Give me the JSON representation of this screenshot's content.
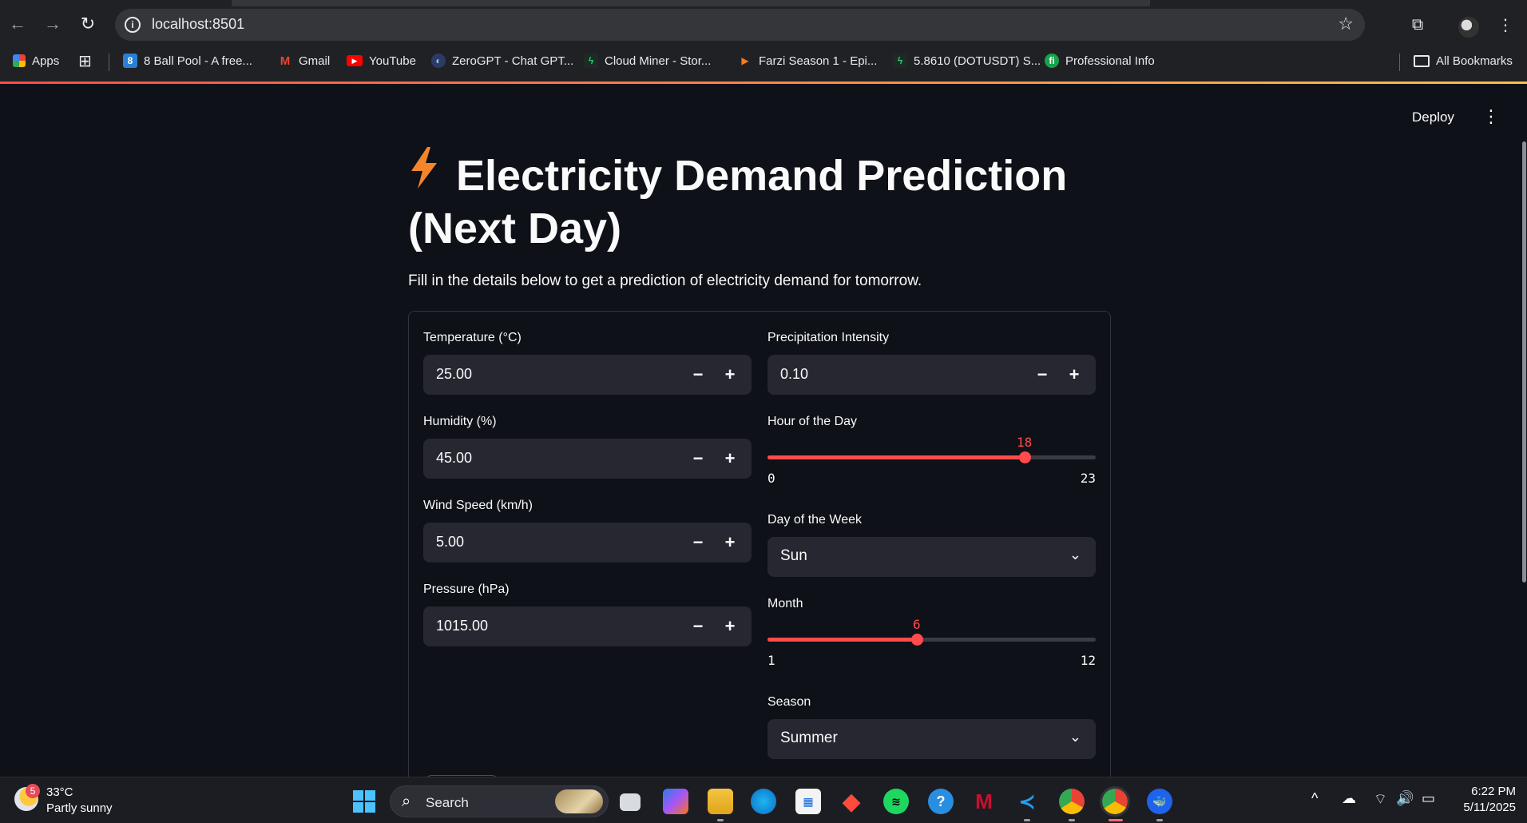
{
  "browser": {
    "url": "localhost:8501",
    "bookmarks": [
      {
        "label": "Apps",
        "icon": "apps-grid-icon"
      },
      {
        "label": "8 Ball Pool - A free...",
        "icon": "8ball-pool-favicon"
      },
      {
        "label": "Gmail",
        "icon": "gmail-icon"
      },
      {
        "label": "YouTube",
        "icon": "youtube-icon"
      },
      {
        "label": "ZeroGPT - Chat GPT...",
        "icon": "zerogpt-favicon"
      },
      {
        "label": "Cloud Miner - Stor...",
        "icon": "cloud-miner-favicon"
      },
      {
        "label": "Farzi Season 1 - Epi...",
        "icon": "play-favicon"
      },
      {
        "label": "5.8610 (DOTUSDT) S...",
        "icon": "dotusdt-favicon"
      },
      {
        "label": "Professional Info",
        "icon": "professional-info-favicon"
      }
    ],
    "all_bookmarks_label": "All Bookmarks"
  },
  "app": {
    "deploy_label": "Deploy",
    "title_line1": "Electricity Demand Prediction",
    "title_line2": "(Next Day)",
    "subtitle": "Fill in the details below to get a prediction of electricity demand for tomorrow.",
    "left_fields": [
      {
        "label": "Temperature (°C)",
        "value": "25.00"
      },
      {
        "label": "Humidity (%)",
        "value": "45.00"
      },
      {
        "label": "Wind Speed (km/h)",
        "value": "5.00"
      },
      {
        "label": "Pressure (hPa)",
        "value": "1015.00"
      }
    ],
    "precipitation": {
      "label": "Precipitation Intensity",
      "value": "0.10"
    },
    "hour_slider": {
      "label": "Hour of the Day",
      "value": 18,
      "min": 0,
      "max": 23
    },
    "day_select": {
      "label": "Day of the Week",
      "value": "Sun"
    },
    "month_slider": {
      "label": "Month",
      "value": 6,
      "min": 1,
      "max": 12
    },
    "season_select": {
      "label": "Season",
      "value": "Summer"
    },
    "accent_color": "#ff4b4b"
  },
  "taskbar": {
    "weather_badge": "5",
    "weather_temp": "33°C",
    "weather_desc": "Partly sunny",
    "search_label": "Search",
    "time": "6:22 PM",
    "date": "5/11/2025"
  }
}
